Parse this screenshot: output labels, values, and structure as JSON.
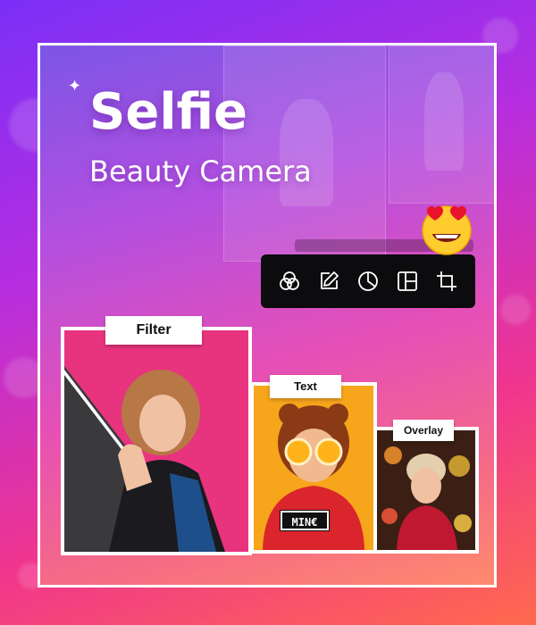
{
  "hero": {
    "title": "Selfie",
    "subtitle": "Beauty Camera"
  },
  "toolbar": {
    "tools": [
      {
        "name": "filter",
        "icon": "circles-filter-icon"
      },
      {
        "name": "edit",
        "icon": "edit-pencil-icon"
      },
      {
        "name": "sticker",
        "icon": "sticker-peel-icon"
      },
      {
        "name": "layout",
        "icon": "layout-grid-icon"
      },
      {
        "name": "crop",
        "icon": "crop-icon"
      }
    ]
  },
  "cards": {
    "filter_label": "Filter",
    "text_label": "Text",
    "overlay_label": "Overlay",
    "text_sticker": "MIN€"
  },
  "colors": {
    "gradient_start": "#7b2ff7",
    "gradient_end": "#ff6a4d",
    "toolbar_bg": "#0c0c0e",
    "accent_pink": "#e8337e",
    "accent_orange": "#f7a51b"
  },
  "emoji": "heart-eyes-emoji-icon"
}
